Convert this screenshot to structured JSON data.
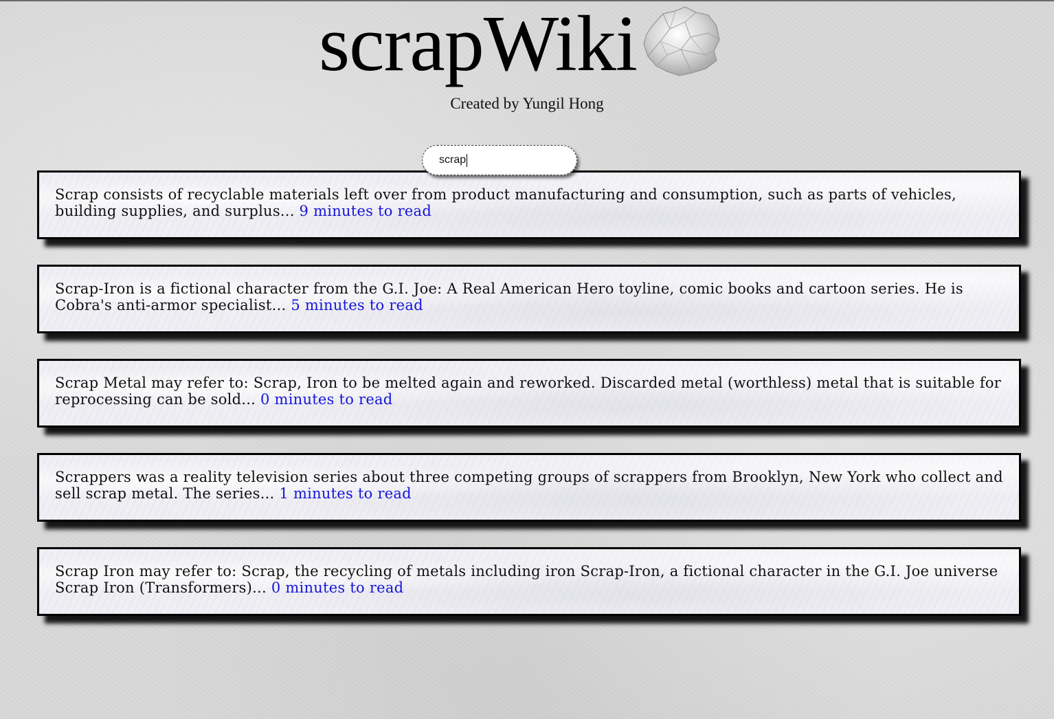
{
  "header": {
    "title": "scrapWiki",
    "logo_icon": "crumpled-paper-icon",
    "subtitle": "Created by Yungil Hong"
  },
  "search": {
    "value": "scrap",
    "placeholder": ""
  },
  "colors": {
    "background": "#d8d8d8",
    "card_background": "#eeeef4",
    "card_border": "#000000",
    "link": "#1515d9"
  },
  "results": [
    {
      "snippet": "Scrap consists of recyclable materials left over from product manufacturing and consumption, such as parts of vehicles, building supplies, and surplus...",
      "read_time": "9 minutes to read"
    },
    {
      "snippet": "Scrap-Iron is a fictional character from the G.I. Joe: A Real American Hero toyline, comic books and cartoon series. He is Cobra's anti-armor specialist...",
      "read_time": "5 minutes to read"
    },
    {
      "snippet": "Scrap Metal may refer to: Scrap, Iron to be melted again and reworked. Discarded metal (worthless) metal that is suitable for reprocessing can be sold...",
      "read_time": "0 minutes to read"
    },
    {
      "snippet": "Scrappers was a reality television series about three competing groups of scrappers from Brooklyn, New York who collect and sell scrap metal. The series...",
      "read_time": "1 minutes to read"
    },
    {
      "snippet": "Scrap Iron may refer to: Scrap, the recycling of metals including iron Scrap-Iron, a fictional character in the G.I. Joe universe Scrap Iron (Transformers)...",
      "read_time": "0 minutes to read"
    }
  ]
}
